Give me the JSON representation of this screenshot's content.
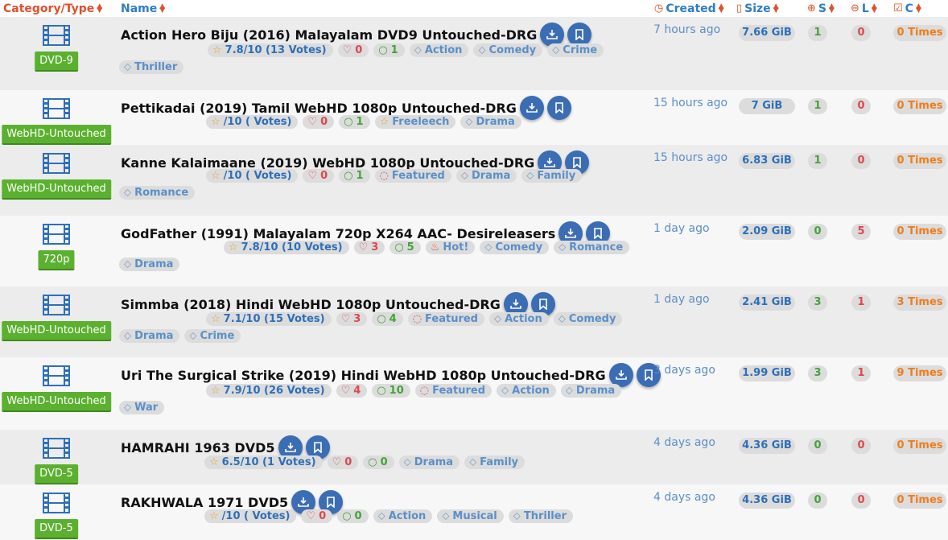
{
  "headers": {
    "category": "Category/Type",
    "name": "Name",
    "created": "Created",
    "size": "Size",
    "seeders": "S",
    "leechers": "L",
    "completed": "C"
  },
  "rows": [
    {
      "category": "DVD-9",
      "title": "Action Hero Biju (2016) Malayalam DVD9 Untouched-DRG",
      "tags": [
        {
          "kind": "vote",
          "text": "7.8/10 (13 Votes)"
        },
        {
          "kind": "like",
          "text": "0"
        },
        {
          "kind": "comm",
          "text": "1"
        },
        {
          "kind": "genre",
          "text": "Action"
        },
        {
          "kind": "genre",
          "text": "Comedy"
        },
        {
          "kind": "genre",
          "text": "Crime"
        },
        {
          "kind": "genre",
          "text": "Thriller"
        }
      ],
      "created": "7 hours ago",
      "size": "7.66 GiB",
      "s": "1",
      "l": "0",
      "c": "0 Times"
    },
    {
      "category": "WebHD-Untouched",
      "title": "Pettikadai (2019) Tamil WebHD 1080p Untouched-DRG",
      "tags": [
        {
          "kind": "vote",
          "text": "/10 ( Votes)"
        },
        {
          "kind": "like",
          "text": "0"
        },
        {
          "kind": "comm",
          "text": "1"
        },
        {
          "kind": "free",
          "text": "Freeleech"
        },
        {
          "kind": "genre",
          "text": "Drama"
        }
      ],
      "created": "15 hours ago",
      "size": "7 GiB",
      "s": "1",
      "l": "0",
      "c": "0 Times"
    },
    {
      "category": "WebHD-Untouched",
      "title": "Kanne Kalaimaane (2019) WebHD 1080p Untouched-DRG",
      "tags": [
        {
          "kind": "vote",
          "text": "/10 ( Votes)"
        },
        {
          "kind": "like",
          "text": "0"
        },
        {
          "kind": "comm",
          "text": "1"
        },
        {
          "kind": "feat",
          "text": "Featured"
        },
        {
          "kind": "genre",
          "text": "Drama"
        },
        {
          "kind": "genre",
          "text": "Family"
        },
        {
          "kind": "genre",
          "text": "Romance"
        }
      ],
      "created": "15 hours ago",
      "size": "6.83 GiB",
      "s": "1",
      "l": "0",
      "c": "0 Times"
    },
    {
      "category": "720p",
      "title": "GodFather (1991) Malayalam 720p X264 AAC- Desireleasers",
      "tags": [
        {
          "kind": "vote",
          "text": "7.8/10 (10 Votes)"
        },
        {
          "kind": "like",
          "text": "3"
        },
        {
          "kind": "comm",
          "text": "5"
        },
        {
          "kind": "hot",
          "text": "Hot!"
        },
        {
          "kind": "genre",
          "text": "Comedy"
        },
        {
          "kind": "genre",
          "text": "Romance"
        },
        {
          "kind": "genre",
          "text": "Drama"
        }
      ],
      "created": "1 day ago",
      "size": "2.09 GiB",
      "s": "0",
      "l": "5",
      "c": "0 Times"
    },
    {
      "category": "WebHD-Untouched",
      "title": "Simmba (2018) Hindi WebHD 1080p Untouched-DRG",
      "tags": [
        {
          "kind": "vote",
          "text": "7.1/10 (15 Votes)"
        },
        {
          "kind": "like",
          "text": "3"
        },
        {
          "kind": "comm",
          "text": "4"
        },
        {
          "kind": "feat",
          "text": "Featured"
        },
        {
          "kind": "genre",
          "text": "Action"
        },
        {
          "kind": "genre",
          "text": "Comedy"
        },
        {
          "kind": "genre",
          "text": "Drama"
        },
        {
          "kind": "genre",
          "text": "Crime"
        }
      ],
      "created": "1 day ago",
      "size": "2.41 GiB",
      "s": "3",
      "l": "1",
      "c": "3 Times"
    },
    {
      "category": "WebHD-Untouched",
      "title": "Uri The Surgical Strike (2019) Hindi WebHD 1080p Untouched-DRG",
      "tags": [
        {
          "kind": "vote",
          "text": "7.9/10 (26 Votes)"
        },
        {
          "kind": "like",
          "text": "4"
        },
        {
          "kind": "comm",
          "text": "10"
        },
        {
          "kind": "feat",
          "text": "Featured"
        },
        {
          "kind": "genre",
          "text": "Action"
        },
        {
          "kind": "genre",
          "text": "Drama"
        },
        {
          "kind": "genre",
          "text": "War"
        }
      ],
      "created": "3 days ago",
      "size": "1.99 GiB",
      "s": "3",
      "l": "1",
      "c": "9 Times"
    },
    {
      "category": "DVD-5",
      "title": "HAMRAHI 1963 DVD5",
      "tags": [
        {
          "kind": "vote",
          "text": "6.5/10 (1 Votes)"
        },
        {
          "kind": "like",
          "text": "0"
        },
        {
          "kind": "comm",
          "text": "0"
        },
        {
          "kind": "genre",
          "text": "Drama"
        },
        {
          "kind": "genre",
          "text": "Family"
        }
      ],
      "created": "4 days ago",
      "size": "4.36 GiB",
      "s": "0",
      "l": "0",
      "c": "0 Times"
    },
    {
      "category": "DVD-5",
      "title": "RAKHWALA 1971 DVD5",
      "tags": [
        {
          "kind": "vote",
          "text": "/10 ( Votes)"
        },
        {
          "kind": "like",
          "text": "0"
        },
        {
          "kind": "comm",
          "text": "0"
        },
        {
          "kind": "genre",
          "text": "Action"
        },
        {
          "kind": "genre",
          "text": "Musical"
        },
        {
          "kind": "genre",
          "text": "Thriller"
        }
      ],
      "created": "4 days ago",
      "size": "4.36 GiB",
      "s": "0",
      "l": "0",
      "c": "0 Times"
    }
  ]
}
